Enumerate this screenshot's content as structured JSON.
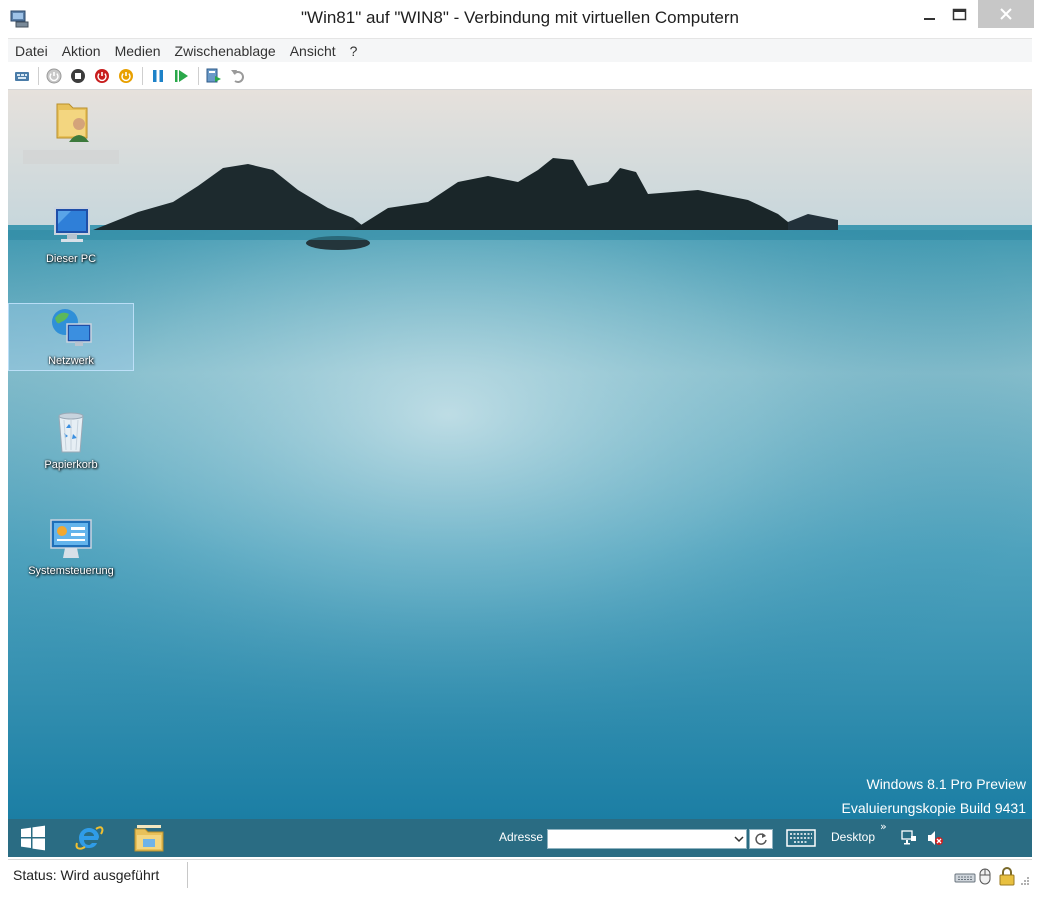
{
  "window": {
    "title": "\"Win81\" auf \"WIN8\" - Verbindung mit virtuellen Computern"
  },
  "menu": {
    "items": [
      "Datei",
      "Aktion",
      "Medien",
      "Zwischenablage",
      "Ansicht",
      "?"
    ]
  },
  "toolbar": {
    "buttons": [
      "ctrl-alt-del-icon",
      "start-icon",
      "turn-off-icon",
      "shutdown-icon",
      "save-icon",
      "pause-icon",
      "reset-icon",
      "checkpoint-icon",
      "revert-icon"
    ]
  },
  "desktop": {
    "icons": [
      {
        "label": "",
        "icon": "user-folder-icon"
      },
      {
        "label": "Dieser PC",
        "icon": "computer-icon"
      },
      {
        "label": "Netzwerk",
        "icon": "network-icon"
      },
      {
        "label": "Papierkorb",
        "icon": "recycle-bin-icon"
      },
      {
        "label": "Systemsteuerung",
        "icon": "control-panel-icon"
      }
    ],
    "watermark": {
      "line1": "Windows 8.1 Pro Preview",
      "line2": "Evaluierungskopie Build 9431"
    }
  },
  "taskbar": {
    "address_label": "Adresse",
    "address_value": "",
    "desktop_label": "Desktop",
    "chevron": "»"
  },
  "status": {
    "text": "Status: Wird ausgeführt"
  },
  "colors": {
    "taskbar": "#186078",
    "close_button": "#c7c7c7"
  }
}
